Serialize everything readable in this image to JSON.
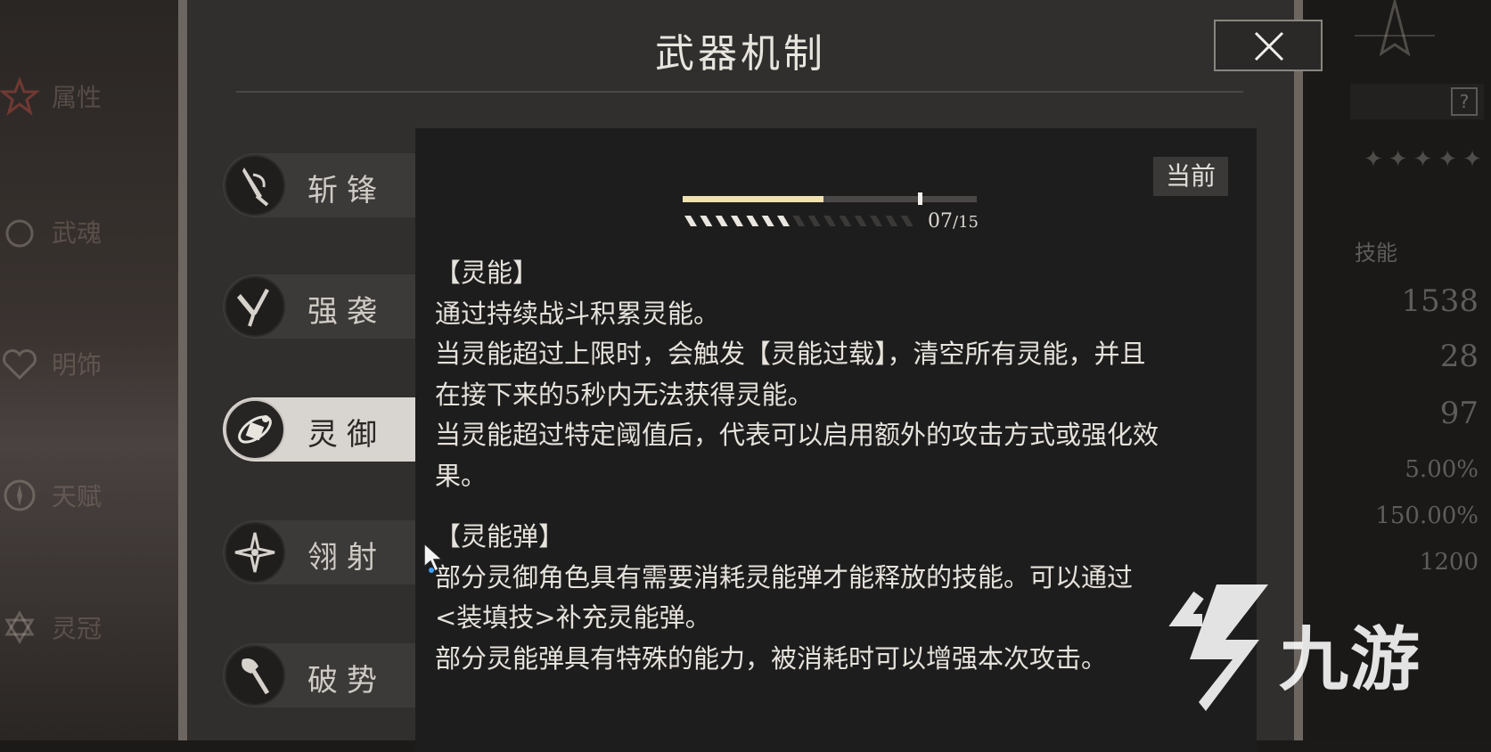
{
  "background": {
    "left_menu": [
      "属性",
      "武魂",
      "明饰",
      "天赋",
      "灵冠"
    ],
    "right_header": "技能",
    "right_help": "?",
    "right_stats": [
      "1538",
      "28",
      "97",
      "5.00%",
      "150.00%",
      "1200"
    ]
  },
  "modal": {
    "title": "武器机制",
    "close_icon": "close-x-icon"
  },
  "tabs": [
    {
      "label": "斩锋",
      "icon": "blade-icon",
      "active": false
    },
    {
      "label": "强袭",
      "icon": "twin-blades-icon",
      "active": false
    },
    {
      "label": "灵御",
      "icon": "orbit-spirit-icon",
      "active": true
    },
    {
      "label": "翎射",
      "icon": "star-shuriken-icon",
      "active": false
    },
    {
      "label": "破势",
      "icon": "axe-icon",
      "active": false
    }
  ],
  "panel": {
    "current_badge": "当前",
    "meter": {
      "current": "07",
      "total": "/15",
      "fill_fraction": 0.48,
      "threshold_fraction": 0.8
    },
    "sections": [
      {
        "title": "【灵能】",
        "lines": [
          "通过持续战斗积累灵能。",
          "当灵能超过上限时，会触发【灵能过载】，清空所有灵能，并且",
          "在接下来的5秒内无法获得灵能。",
          "当灵能超过特定阈值后，代表可以启用额外的攻击方式或强化效",
          "果。"
        ]
      },
      {
        "title": "【灵能弹】",
        "lines": [
          "部分灵御角色具有需要消耗灵能弹才能释放的技能。可以通过",
          "<装填技>补充灵能弹。",
          "部分灵能弹具有特殊的能力，被消耗时可以增强本次攻击。"
        ]
      }
    ]
  },
  "watermark": {
    "text": "九游",
    "logo": "jiuyou-logo-icon"
  },
  "colors": {
    "accent_fill": "#efe2b0",
    "active_tab": "#d8d4cf",
    "panel_bg": "#1e1d1d"
  }
}
